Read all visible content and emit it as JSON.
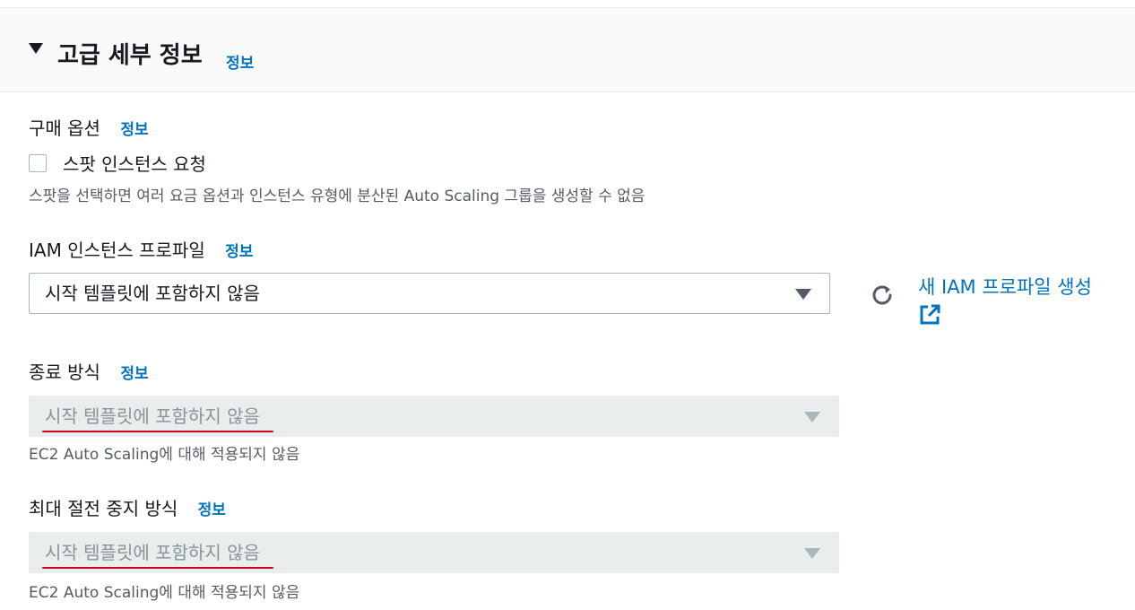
{
  "header": {
    "title": "고급 세부 정보",
    "info": "정보"
  },
  "purchase_options": {
    "label": "구매 옵션",
    "info": "정보",
    "checkbox_label": "스팟 인스턴스 요청",
    "checked": false,
    "description": "스팟을 선택하면 여러 요금 옵션과 인스턴스 유형에 분산된 Auto Scaling 그룹을 생성할 수 없음"
  },
  "iam_profile": {
    "label": "IAM 인스턴스 프로파일",
    "info": "정보",
    "selected": "시작 템플릿에 포함하지 않음",
    "refresh_icon": "refresh-icon",
    "new_link": "새 IAM 프로파일 생성",
    "external_icon": "external-link-icon"
  },
  "shutdown_behavior": {
    "label": "종료 방식",
    "info": "정보",
    "selected": "시작 템플릿에 포함하지 않음",
    "description": "EC2 Auto Scaling에 대해 적용되지 않음"
  },
  "stop_hibernate": {
    "label": "최대 절전 중지 방식",
    "info": "정보",
    "selected": "시작 템플릿에 포함하지 않음",
    "description": "EC2 Auto Scaling에 대해 적용되지 않음"
  },
  "colors": {
    "link": "#0073bb",
    "annotation": "#d0021b",
    "disabled_bg": "#eaeded"
  }
}
